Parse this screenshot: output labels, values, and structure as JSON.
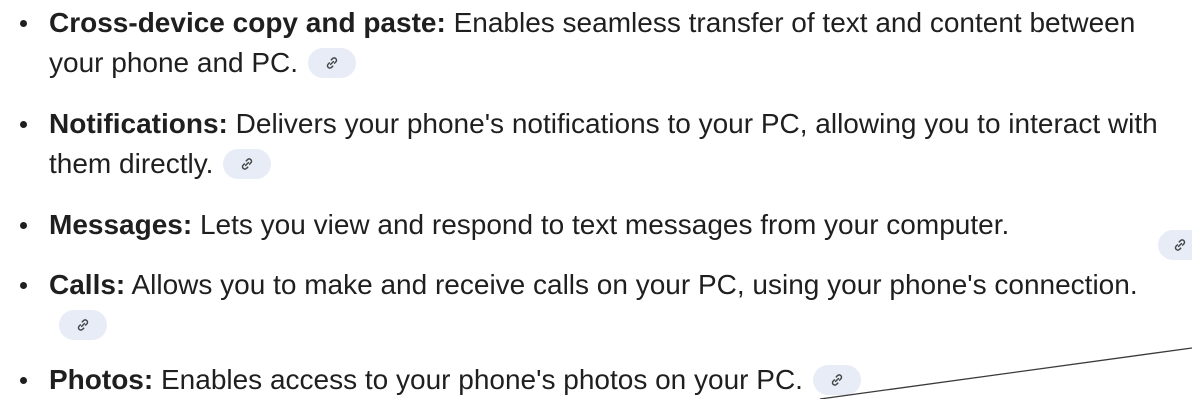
{
  "features": [
    {
      "term": "Cross-device copy and paste:",
      "description": " Enables seamless transfer of text and content between your phone and PC.",
      "source_icon": "link-icon"
    },
    {
      "term": "Notifications:",
      "description": " Delivers your phone's notifications to your PC, allowing you to interact with them directly.",
      "source_icon": "link-icon"
    },
    {
      "term": "Messages:",
      "description": " Lets you view and respond to text messages from your computer.",
      "source_icon": "link-icon"
    },
    {
      "term": "Calls:",
      "description": " Allows you to make and receive calls on your PC, using your phone's connection.",
      "source_icon": "link-icon"
    },
    {
      "term": "Photos:",
      "description": " Enables access to your phone's photos on your PC.",
      "source_icon": "link-icon"
    }
  ],
  "colors": {
    "text": "#1f1f1f",
    "chip_background": "#e8ecf7",
    "chip_icon": "#444746"
  }
}
